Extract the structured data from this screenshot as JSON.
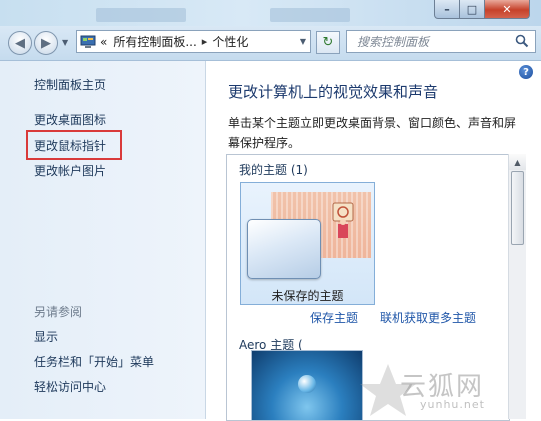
{
  "window": {
    "min_label": "–",
    "max_label": "□",
    "close_label": "✕"
  },
  "nav": {
    "back_label": "◀",
    "forward_label": "▶",
    "address_prefix": "«",
    "address_crumb_1": "所有控制面板...",
    "address_crumb_sep": "▸",
    "address_crumb_2": "个性化",
    "refresh_label": "↻",
    "search_placeholder": "搜索控制面板"
  },
  "sidebar": {
    "home": "控制面板主页",
    "links": [
      "更改桌面图标",
      "更改鼠标指针",
      "更改帐户图片"
    ],
    "see_also_heading": "另请参阅",
    "see_also": [
      "显示",
      "任务栏和「开始」菜单",
      "轻松访问中心"
    ]
  },
  "main": {
    "help_label": "?",
    "title": "更改计算机上的视觉效果和声音",
    "description": "单击某个主题立即更改桌面背景、窗口颜色、声音和屏幕保护程序。",
    "my_themes_heading": "我的主题 (1)",
    "unsaved_theme_name": "未保存的主题",
    "save_theme_link": "保存主题",
    "get_more_link": "联机获取更多主题",
    "aero_heading": "Aero 主题 (",
    "aero_count_suffix": ""
  },
  "watermark": {
    "text": "云狐网",
    "url": "yunhu.net"
  },
  "colors": {
    "highlight_box": "#d93a3a",
    "link": "#1f56a8",
    "title": "#1c3a6e"
  }
}
